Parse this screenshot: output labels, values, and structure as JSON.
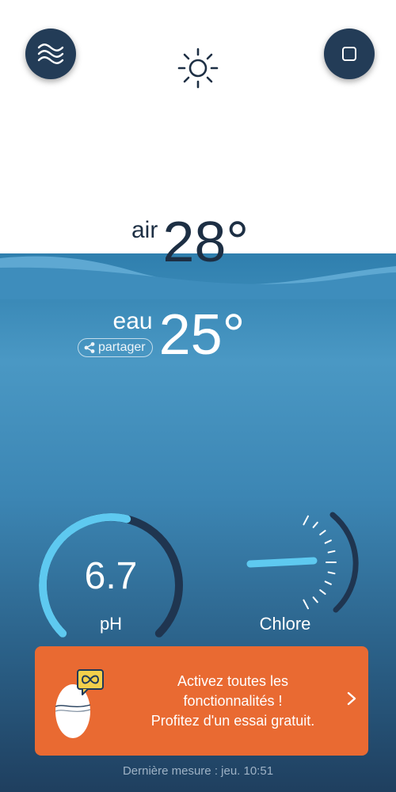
{
  "header": {
    "menu_icon": "waves-icon",
    "weather_icon": "sun-icon",
    "stop_icon": "stop-square-icon"
  },
  "air": {
    "label": "air",
    "value": "28°"
  },
  "water": {
    "label": "eau",
    "value": "25°",
    "share_label": "partager",
    "share_icon": "share-icon"
  },
  "ph": {
    "value": "6.7",
    "label": "pH",
    "level": 0.55
  },
  "chlore": {
    "label": "Chlore"
  },
  "promo": {
    "lines": [
      "Activez toutes les",
      "fonctionnalités !",
      "Profitez d'un essai gratuit."
    ],
    "icon": "sensor-infinity-icon",
    "chevron_icon": "chevron-right-icon"
  },
  "footer": {
    "last_measure": "Dernière mesure : jeu. 10:51"
  },
  "colors": {
    "dark_navy": "#233c57",
    "gauge_blue": "#5ec9f0",
    "promo_orange": "#e96a32"
  }
}
